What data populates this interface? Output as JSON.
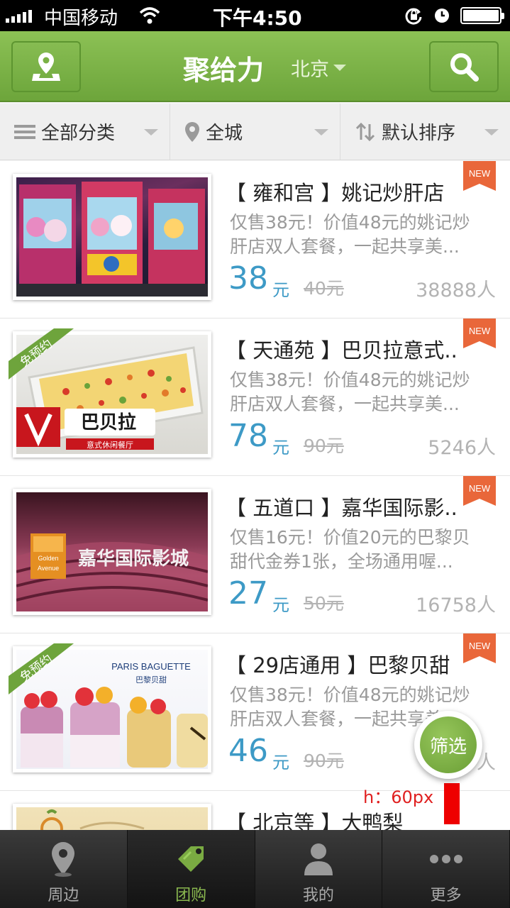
{
  "status_bar": {
    "carrier": "中国移动",
    "time": "下午4:50"
  },
  "header": {
    "title": "聚给力",
    "city": "北京"
  },
  "filters": [
    {
      "label": "全部分类",
      "icon": "menu-icon"
    },
    {
      "label": "全城",
      "icon": "location-pin-icon"
    },
    {
      "label": "默认排序",
      "icon": "sort-arrows-icon"
    }
  ],
  "deals": [
    {
      "title": "【 雍和宫 】姚记炒肝店",
      "desc_line1": "仅售38元！价值48元的姚记炒",
      "desc_line2": "肝店双人套餐，一起共享美...",
      "price": "38",
      "unit": "元",
      "original": "40元",
      "sold": "38888人",
      "badge": "NEW",
      "image": "arcade-claw-machines"
    },
    {
      "title": "【 天通苑 】巴贝拉意式..",
      "desc_line1": "仅售38元！价值48元的姚记炒",
      "desc_line2": "肝店双人套餐，一起共享美...",
      "price": "78",
      "unit": "元",
      "original": "90元",
      "sold": "5246人",
      "badge": "NEW",
      "ribbon": "免预约",
      "image": "baked-pasta",
      "logo_text": "意式休闲餐厅"
    },
    {
      "title": "【 五道口 】嘉华国际影..",
      "desc_line1": "仅售16元！价值20元的巴黎贝",
      "desc_line2": "甜代金券1张，全场通用喔...",
      "price": "27",
      "unit": "元",
      "original": "50元",
      "sold": "16758人",
      "badge": "NEW",
      "image": "cinema-hall",
      "logo_text": "嘉华国际影城",
      "logo_en": "Golden Avenue"
    },
    {
      "title": "【 29店通用 】巴黎贝甜",
      "desc_line1": "仅售38元！价值48元的姚记炒",
      "desc_line2": "肝店双人套餐，一起共享美...",
      "price": "46",
      "unit": "元",
      "original": "90元",
      "sold": "人",
      "badge": "NEW",
      "ribbon": "免预约",
      "image": "fruit-parfaits",
      "logo_text": "PARIS BAGUETTE",
      "logo_cn": "巴黎贝甜"
    },
    {
      "title": "【 北京等 】大鸭梨",
      "image": "restaurant-logo"
    }
  ],
  "fab": {
    "label": "筛选"
  },
  "annotation": {
    "text": "h：60px"
  },
  "tabs": [
    {
      "label": "周边",
      "icon": "location-icon",
      "active": false
    },
    {
      "label": "团购",
      "icon": "tag-icon",
      "active": true
    },
    {
      "label": "我的",
      "icon": "user-icon",
      "active": false
    },
    {
      "label": "更多",
      "icon": "more-dots-icon",
      "active": false
    }
  ],
  "colors": {
    "brand_green": "#7ab144",
    "price_blue": "#3d9ac6",
    "new_badge": "#e9673a"
  }
}
